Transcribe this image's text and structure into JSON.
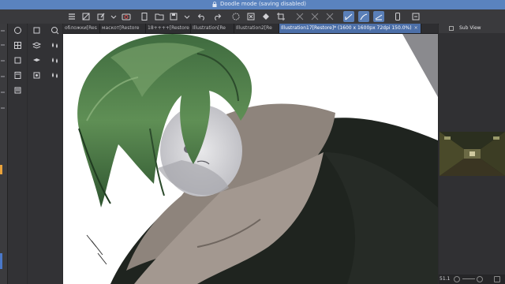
{
  "window": {
    "title": "Doodle mode (saving disabled)"
  },
  "tabs": [
    {
      "label": "обложки[Res",
      "active": false
    },
    {
      "label": "маскот[Restore",
      "active": false
    },
    {
      "label": "18++++[Restore",
      "active": false
    },
    {
      "label": "Illustration[Re",
      "active": false
    },
    {
      "label": "Illustration2[Re",
      "active": false
    },
    {
      "label": "Illustration17[Restore]* (1600 x 1600px 72dpi 150.0%)",
      "active": true,
      "close": "×"
    }
  ],
  "sub_view": {
    "label": "Sub View"
  },
  "status": {
    "zoom": "51.1"
  },
  "colors": {
    "titlebar": "#5a83bf",
    "active_tab": "#4c6fa8",
    "selected_tool": "#5a7fb8"
  }
}
